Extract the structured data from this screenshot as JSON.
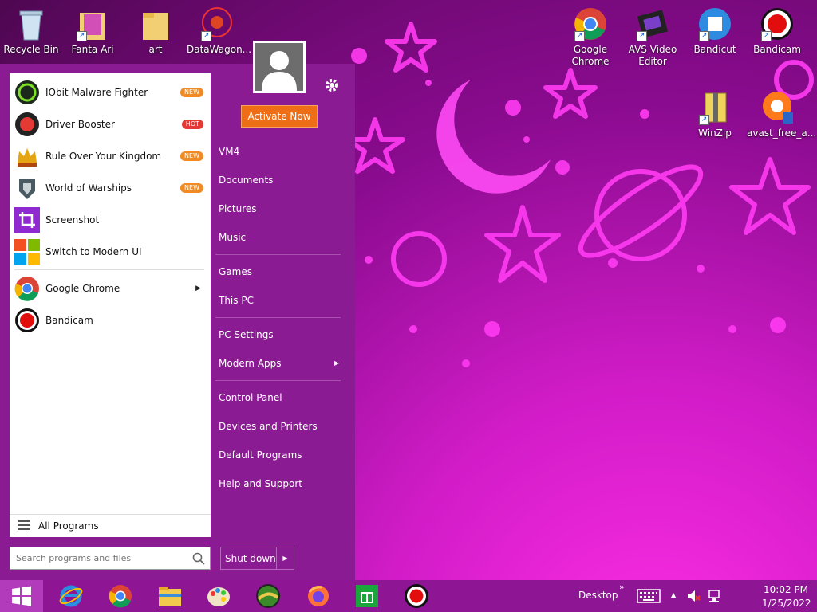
{
  "desktop": {
    "icons": [
      {
        "label": "Recycle Bin",
        "icon": "recycle-bin-icon"
      },
      {
        "label": "Fanta Ari",
        "icon": "folder-icon"
      },
      {
        "label": "art",
        "icon": "folder-icon"
      },
      {
        "label": "DataWagon...",
        "icon": "datawagon-icon"
      },
      {
        "label": "Google Chrome",
        "icon": "chrome-icon"
      },
      {
        "label": "AVS Video Editor",
        "icon": "avs-video-editor-icon"
      },
      {
        "label": "Bandicut",
        "icon": "bandicut-icon"
      },
      {
        "label": "Bandicam",
        "icon": "bandicam-icon"
      },
      {
        "label": "WinZip",
        "icon": "winzip-icon"
      },
      {
        "label": "avast_free_a...",
        "icon": "avast-icon"
      }
    ]
  },
  "start_menu": {
    "programs": [
      {
        "label": "IObit Malware Fighter",
        "badge": "NEW",
        "badge_color": "#f08a24"
      },
      {
        "label": "Driver Booster",
        "badge": "HOT",
        "badge_color": "#e53935"
      },
      {
        "label": "Rule Over Your Kingdom",
        "badge": "NEW",
        "badge_color": "#f08a24"
      },
      {
        "label": "World of Warships",
        "badge": "NEW",
        "badge_color": "#f08a24"
      },
      {
        "label": "Screenshot",
        "badge": ""
      },
      {
        "label": "Switch to Modern UI",
        "badge": ""
      },
      {
        "label": "Google Chrome",
        "badge": ""
      },
      {
        "label": "Bandicam",
        "badge": ""
      }
    ],
    "all_programs": "All Programs",
    "search_placeholder": "Search programs and files",
    "activate": "Activate Now",
    "right_links": [
      "VM4",
      "Documents",
      "Pictures",
      "Music",
      "Games",
      "This PC",
      "PC Settings",
      "Modern Apps",
      "Control Panel",
      "Devices and Printers",
      "Default Programs",
      "Help and Support"
    ],
    "shut_down": "Shut down"
  },
  "taskbar": {
    "desktop_label": "Desktop",
    "chevron": "»",
    "time": "10:02 PM",
    "date": "1/25/2022"
  },
  "colors": {
    "accent": "#8b1b93",
    "activate": "#ee6e17"
  }
}
